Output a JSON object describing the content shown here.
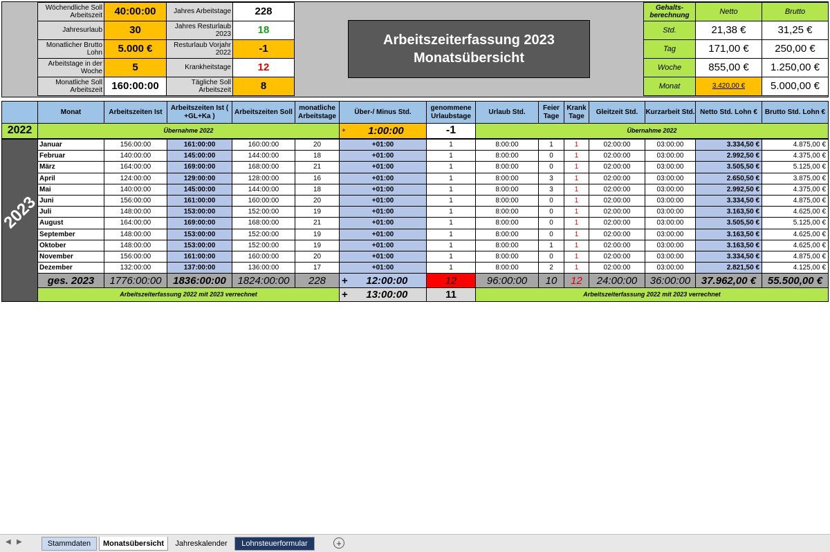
{
  "summary_left": [
    {
      "label": "Wöchendliche Soll Arbeitszeit",
      "value": "40:00:00"
    },
    {
      "label": "Jahresurlaub",
      "value": "30"
    },
    {
      "label": "Monatlicher Brutto Lohn",
      "value": "5.000 €"
    },
    {
      "label": "Arbeitstage in der Woche",
      "value": "5"
    },
    {
      "label": "Monatliche Soll Arbeitszeit",
      "value": "160:00:00"
    }
  ],
  "summary_mid": [
    {
      "label": "Jahres Arbeitstage",
      "value": "228"
    },
    {
      "label": "Jahres Resturlaub 2023",
      "value": "18"
    },
    {
      "label": "Resturlaub Vorjahr 2022",
      "value": "-1"
    },
    {
      "label": "Krankheitstage",
      "value": "12"
    },
    {
      "label": "Tägliche Soll Arbeitszeit",
      "value": "8"
    }
  ],
  "title": {
    "line1": "Arbeitszeiterfassung   2023",
    "line2": "Monatsübersicht"
  },
  "salary": {
    "header": "Gehalts-berechnung",
    "netto_header": "Netto",
    "brutto_header": "Brutto",
    "rows": [
      {
        "label": "Std.",
        "netto": "21,38 €",
        "brutto": "31,25 €"
      },
      {
        "label": "Tag",
        "netto": "171,00 €",
        "brutto": "250,00 €"
      },
      {
        "label": "Woche",
        "netto": "855,00 €",
        "brutto": "1.250,00 €"
      },
      {
        "label": "Monat",
        "netto": "3.420,00 €",
        "brutto": "5.000,00 €"
      }
    ]
  },
  "table": {
    "headers": [
      "Monat",
      "Arbeitszeiten Ist",
      "Arbeitszeiten Ist ( +GL+Ka )",
      "Arbeitszeiten Soll",
      "monatliche Arbeitstage",
      "Über-/ Minus Std.",
      "genommene Urlaubstage",
      "Urlaub Std.",
      "Feier Tage",
      "Krank Tage",
      "Gleitzeit Std.",
      "Kurzarbeit Std.",
      "Netto Std. Lohn €",
      "Brutto Std. Lohn €"
    ],
    "prev_year": "2022",
    "uebernahme_label": "Übernahme  2022",
    "uebernahme_plus": "+",
    "uebernahme_hours": "1:00:00",
    "uebernahme_vacation": "-1",
    "year_label": "2023",
    "rows": [
      {
        "monat": "Januar",
        "ist": "156:00:00",
        "ist_gl": "161:00:00",
        "soll": "160:00:00",
        "tage": "20",
        "ueber": "+01:00",
        "urlaub_tage": "1",
        "urlaub_std": "8:00:00",
        "feier": "1",
        "krank": "1",
        "gleit": "02:00:00",
        "kurz": "03:00:00",
        "netto": "3.334,50 €",
        "brutto": "4.875,00 €"
      },
      {
        "monat": "Februar",
        "ist": "140:00:00",
        "ist_gl": "145:00:00",
        "soll": "144:00:00",
        "tage": "18",
        "ueber": "+01:00",
        "urlaub_tage": "1",
        "urlaub_std": "8:00:00",
        "feier": "0",
        "krank": "1",
        "gleit": "02:00:00",
        "kurz": "03:00:00",
        "netto": "2.992,50 €",
        "brutto": "4.375,00 €"
      },
      {
        "monat": "März",
        "ist": "164:00:00",
        "ist_gl": "169:00:00",
        "soll": "168:00:00",
        "tage": "21",
        "ueber": "+01:00",
        "urlaub_tage": "1",
        "urlaub_std": "8:00:00",
        "feier": "0",
        "krank": "1",
        "gleit": "02:00:00",
        "kurz": "03:00:00",
        "netto": "3.505,50 €",
        "brutto": "5.125,00 €"
      },
      {
        "monat": "April",
        "ist": "124:00:00",
        "ist_gl": "129:00:00",
        "soll": "128:00:00",
        "tage": "16",
        "ueber": "+01:00",
        "urlaub_tage": "1",
        "urlaub_std": "8:00:00",
        "feier": "3",
        "krank": "1",
        "gleit": "02:00:00",
        "kurz": "03:00:00",
        "netto": "2.650,50 €",
        "brutto": "3.875,00 €"
      },
      {
        "monat": "Mai",
        "ist": "140:00:00",
        "ist_gl": "145:00:00",
        "soll": "144:00:00",
        "tage": "18",
        "ueber": "+01:00",
        "urlaub_tage": "1",
        "urlaub_std": "8:00:00",
        "feier": "3",
        "krank": "1",
        "gleit": "02:00:00",
        "kurz": "03:00:00",
        "netto": "2.992,50 €",
        "brutto": "4.375,00 €"
      },
      {
        "monat": "Juni",
        "ist": "156:00:00",
        "ist_gl": "161:00:00",
        "soll": "160:00:00",
        "tage": "20",
        "ueber": "+01:00",
        "urlaub_tage": "1",
        "urlaub_std": "8:00:00",
        "feier": "0",
        "krank": "1",
        "gleit": "02:00:00",
        "kurz": "03:00:00",
        "netto": "3.334,50 €",
        "brutto": "4.875,00 €"
      },
      {
        "monat": "Juli",
        "ist": "148:00:00",
        "ist_gl": "153:00:00",
        "soll": "152:00:00",
        "tage": "19",
        "ueber": "+01:00",
        "urlaub_tage": "1",
        "urlaub_std": "8:00:00",
        "feier": "0",
        "krank": "1",
        "gleit": "02:00:00",
        "kurz": "03:00:00",
        "netto": "3.163,50 €",
        "brutto": "4.625,00 €"
      },
      {
        "monat": "August",
        "ist": "164:00:00",
        "ist_gl": "169:00:00",
        "soll": "168:00:00",
        "tage": "21",
        "ueber": "+01:00",
        "urlaub_tage": "1",
        "urlaub_std": "8:00:00",
        "feier": "0",
        "krank": "1",
        "gleit": "02:00:00",
        "kurz": "03:00:00",
        "netto": "3.505,50 €",
        "brutto": "5.125,00 €"
      },
      {
        "monat": "September",
        "ist": "148:00:00",
        "ist_gl": "153:00:00",
        "soll": "152:00:00",
        "tage": "19",
        "ueber": "+01:00",
        "urlaub_tage": "1",
        "urlaub_std": "8:00:00",
        "feier": "0",
        "krank": "1",
        "gleit": "02:00:00",
        "kurz": "03:00:00",
        "netto": "3.163,50 €",
        "brutto": "4.625,00 €"
      },
      {
        "monat": "Oktober",
        "ist": "148:00:00",
        "ist_gl": "153:00:00",
        "soll": "152:00:00",
        "tage": "19",
        "ueber": "+01:00",
        "urlaub_tage": "1",
        "urlaub_std": "8:00:00",
        "feier": "1",
        "krank": "1",
        "gleit": "02:00:00",
        "kurz": "03:00:00",
        "netto": "3.163,50 €",
        "brutto": "4.625,00 €"
      },
      {
        "monat": "November",
        "ist": "156:00:00",
        "ist_gl": "161:00:00",
        "soll": "160:00:00",
        "tage": "20",
        "ueber": "+01:00",
        "urlaub_tage": "1",
        "urlaub_std": "8:00:00",
        "feier": "0",
        "krank": "1",
        "gleit": "02:00:00",
        "kurz": "03:00:00",
        "netto": "3.334,50 €",
        "brutto": "4.875,00 €"
      },
      {
        "monat": "Dezember",
        "ist": "132:00:00",
        "ist_gl": "137:00:00",
        "soll": "136:00:00",
        "tage": "17",
        "ueber": "+01:00",
        "urlaub_tage": "1",
        "urlaub_std": "8:00:00",
        "feier": "2",
        "krank": "1",
        "gleit": "02:00:00",
        "kurz": "03:00:00",
        "netto": "2.821,50 €",
        "brutto": "4.125,00 €"
      }
    ],
    "totals": {
      "label": "ges. 2023",
      "ist": "1776:00:00",
      "ist_gl": "1836:00:00",
      "soll": "1824:00:00",
      "tage": "228",
      "plus": "+",
      "ueber": "12:00:00",
      "urlaub_tage": "12",
      "urlaub_std": "96:00:00",
      "feier": "10",
      "krank": "12",
      "gleit": "24:00:00",
      "kurz": "36:00:00",
      "netto": "37.962,00 €",
      "brutto": "55.500,00 €"
    },
    "carry": {
      "note": "Arbeitszeiterfassung 2022 mit 2023 verrechnet",
      "plus": "+",
      "hours": "13:00:00",
      "vacation": "11"
    }
  },
  "sheet_tabs": [
    "Stammdaten",
    "Monatsübersicht",
    "Jahreskalender",
    "Lohnsteuerformular"
  ],
  "active_tab": "Monatsübersicht",
  "colors": {
    "header_blue": "#9dc3e6",
    "orange": "#ffc000",
    "green": "#b3e64d",
    "red": "#ff0000",
    "dark_gray": "#595959"
  }
}
